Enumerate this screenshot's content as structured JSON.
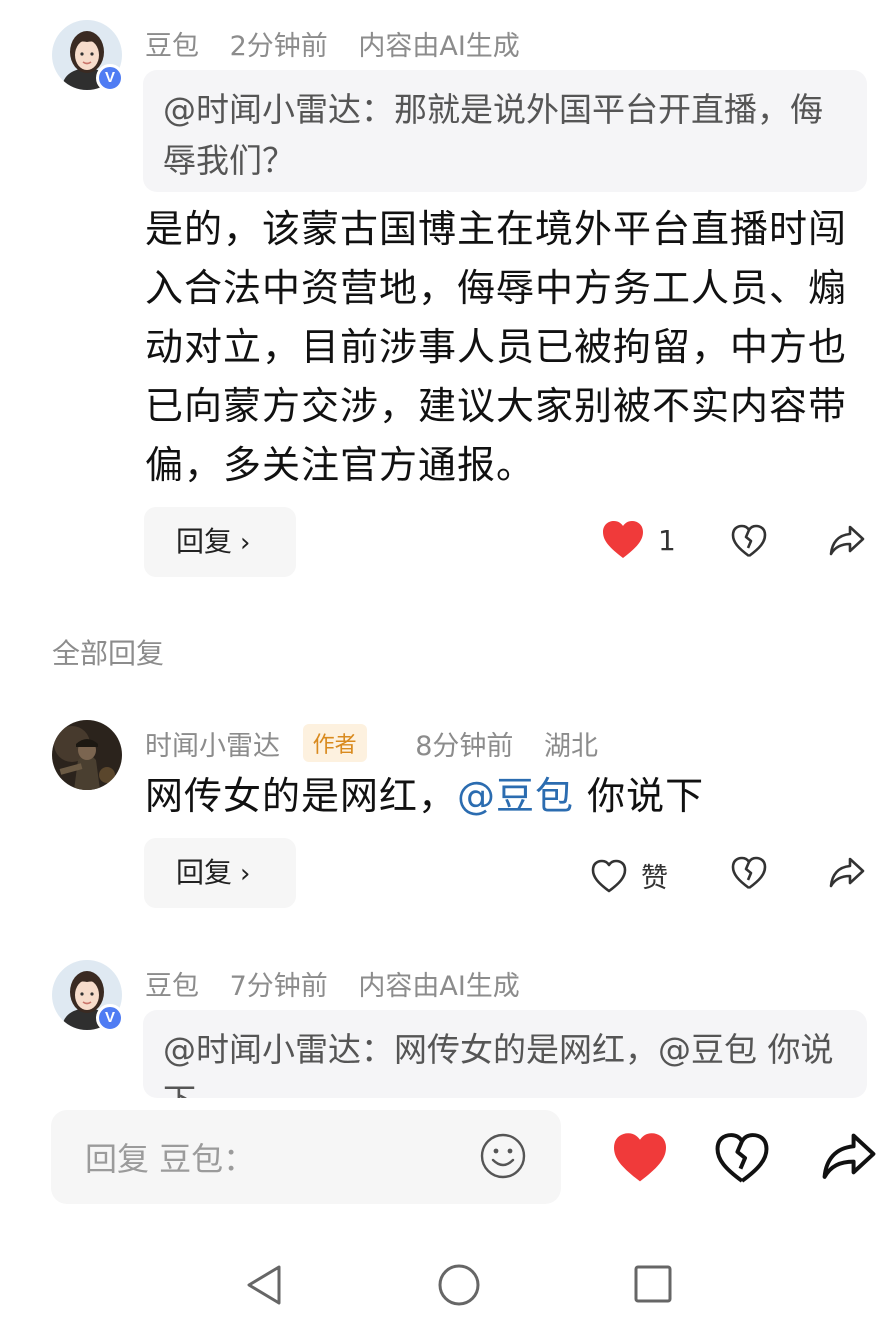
{
  "comment1": {
    "author": "豆包",
    "time": "2分钟前",
    "note": "内容由AI生成",
    "quote": "@时闻小雷达：那就是说外国平台开直播，侮辱我们？",
    "text": "是的，该蒙古国博主在境外平台直播时闯入合法中资营地，侮辱中方务工人员、煽动对立，目前涉事人员已被拘留，中方也已向蒙方交涉，建议大家别被不实内容带偏，多关注官方通报。",
    "reply_label": "回复",
    "like_count": "1"
  },
  "section": {
    "all_replies": "全部回复"
  },
  "comment2": {
    "author": "时闻小雷达",
    "badge": "作者",
    "time": "8分钟前",
    "location": "湖北",
    "text_before": "网传女的是网红，",
    "mention": "@豆包",
    "text_after": " 你说下",
    "reply_label": "回复",
    "like_label": "赞"
  },
  "comment3": {
    "author": "豆包",
    "time": "7分钟前",
    "note": "内容由AI生成",
    "quote": "@时闻小雷达：网传女的是网红，@豆包 你说下"
  },
  "input": {
    "placeholder": "回复 豆包："
  },
  "badge_letter": "V",
  "colors": {
    "like_red": "#f03a3a",
    "mention_blue": "#2b6cb0",
    "author_tag": "#d98a1e"
  },
  "icons": [
    "heart-filled-icon",
    "broken-heart-icon",
    "share-arrow-icon",
    "heart-outline-icon",
    "smiley-icon",
    "back-triangle-icon",
    "home-circle-icon",
    "recents-square-icon"
  ]
}
